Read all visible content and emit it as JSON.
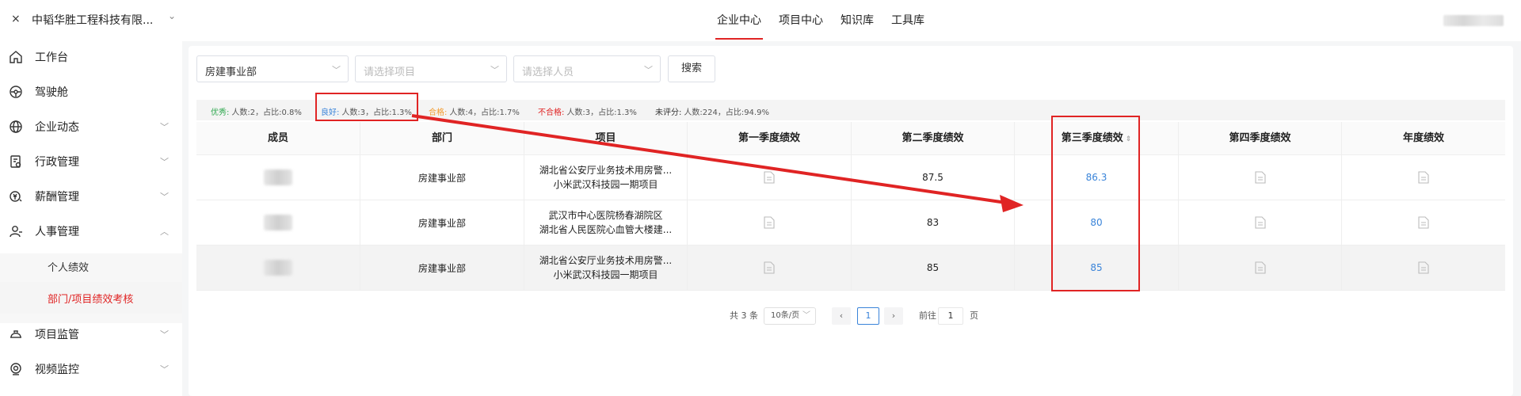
{
  "app": {
    "close_glyph": "×",
    "company": "中韬华胜工程科技有限...",
    "top_nav": [
      {
        "label": "企业中心"
      },
      {
        "label": "项目中心"
      },
      {
        "label": "知识库"
      },
      {
        "label": "工具库"
      }
    ]
  },
  "sidebar": {
    "items": [
      {
        "label": "工作台",
        "icon": "home-icon"
      },
      {
        "label": "驾驶舱",
        "icon": "dashboard-icon"
      },
      {
        "label": "企业动态",
        "icon": "globe-icon"
      },
      {
        "label": "行政管理",
        "icon": "admin-icon"
      },
      {
        "label": "薪酬管理",
        "icon": "salary-icon"
      },
      {
        "label": "人事管理",
        "icon": "user-icon"
      },
      {
        "label": "项目监管",
        "icon": "helmet-icon"
      },
      {
        "label": "视频监控",
        "icon": "camera-icon"
      }
    ],
    "sub_items": [
      {
        "label": "个人绩效"
      },
      {
        "label": "部门/项目绩效考核"
      }
    ]
  },
  "filters": {
    "department": "房建事业部",
    "project_placeholder": "请选择项目",
    "person_placeholder": "请选择人员",
    "search_label": "搜索"
  },
  "stats": [
    {
      "key": "优秀:",
      "value": "人数:2，占比:0.8%"
    },
    {
      "key": "良好:",
      "value": "人数:3，占比:1.3%"
    },
    {
      "key": "合格:",
      "value": "人数:4，占比:1.7%"
    },
    {
      "key": "不合格:",
      "value": "人数:3，占比:1.3%"
    },
    {
      "key": "未评分:",
      "value": "人数:224，占比:94.9%"
    }
  ],
  "table": {
    "headers": [
      "成员",
      "部门",
      "项目",
      "第一季度绩效",
      "第二季度绩效",
      "第三季度绩效",
      "第四季度绩效",
      "年度绩效"
    ],
    "rows": [
      {
        "dept": "房建事业部",
        "project_line1": "湖北省公安厅业务技术用房警...",
        "project_line2": "小米武汉科技园一期项目",
        "q2": "87.5",
        "q3": "86.3"
      },
      {
        "dept": "房建事业部",
        "project_line1": "武汉市中心医院杨春湖院区",
        "project_line2": "湖北省人民医院心血管大楼建...",
        "q2": "83",
        "q3": "80"
      },
      {
        "dept": "房建事业部",
        "project_line1": "湖北省公安厅业务技术用房警...",
        "project_line2": "小米武汉科技园一期项目",
        "q2": "85",
        "q3": "85"
      }
    ]
  },
  "pagination": {
    "total": "共 3 条",
    "page_size": "10条/页",
    "prev": "‹",
    "current": "1",
    "next": "›",
    "goto_label": "前往",
    "goto_value": "1",
    "page_suffix": "页"
  },
  "colors": {
    "accent": "#e02424",
    "link_blue": "#3a84d9",
    "excellent": "#2fa84f",
    "pass": "#f39b2e"
  }
}
